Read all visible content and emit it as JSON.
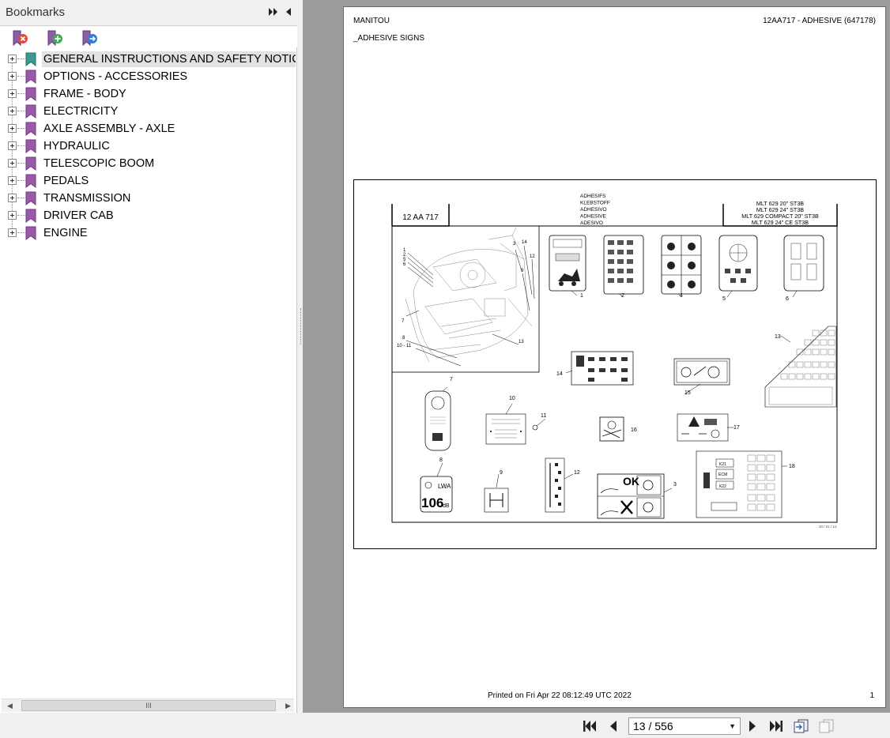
{
  "bookmarks_panel": {
    "title": "Bookmarks",
    "header_icons": [
      "fast-forward-icon",
      "collapse-left-icon"
    ],
    "toolbar_icons": [
      "delete-bookmark-icon",
      "add-bookmark-icon",
      "goto-bookmark-icon"
    ],
    "items": [
      {
        "label": "GENERAL INSTRUCTIONS AND SAFETY NOTICE",
        "selected": true
      },
      {
        "label": "OPTIONS - ACCESSORIES"
      },
      {
        "label": "FRAME - BODY"
      },
      {
        "label": "ELECTRICITY"
      },
      {
        "label": "AXLE ASSEMBLY - AXLE"
      },
      {
        "label": "HYDRAULIC"
      },
      {
        "label": "TELESCOPIC BOOM"
      },
      {
        "label": "PEDALS"
      },
      {
        "label": "TRANSMISSION"
      },
      {
        "label": "DRIVER CAB"
      },
      {
        "label": "ENGINE"
      }
    ],
    "scrollbar_grip": "III"
  },
  "page": {
    "brand": "MANITOU",
    "ref": "12AA717 - ADHESIVE (647178)",
    "subtitle": "_ADHESIVE SIGNS",
    "printed": "Printed on  Fri Apr 22 08:12:49 UTC 2022",
    "page_number": "1",
    "drawing": {
      "part_code": "12 AA 717",
      "title_lines": [
        "ADHESIFS",
        "KLEBSTOFF",
        "ADHESIVO",
        "ADHESIVE",
        "ADESIVO"
      ],
      "models": [
        "MLT 629 20\" ST3B",
        "MLT 629 24\" ST3B",
        "MLT 629 COMPACT 20\" ST3B",
        "MLT 629 24\" CE ST3B"
      ],
      "callouts": [
        "1",
        "2",
        "3",
        "4",
        "5",
        "6",
        "7",
        "8",
        "9",
        "10",
        "11",
        "12",
        "13",
        "14",
        "15",
        "16",
        "17",
        "18"
      ],
      "cab_callouts": [
        "1",
        "2",
        "5",
        "6",
        "7",
        "8",
        "10 - 11",
        "3",
        "14",
        "12",
        "9",
        "13"
      ],
      "sticker_text": {
        "ok": "OK",
        "noise_value": "106",
        "noise_unit": "dB",
        "noise_label": "LWA",
        "relay_k21": "K21",
        "relay_ecm": "ECM",
        "relay_k22": "K22"
      },
      "date": "30 / 01 / 12"
    }
  },
  "navigation": {
    "page_field": "13 / 556"
  }
}
